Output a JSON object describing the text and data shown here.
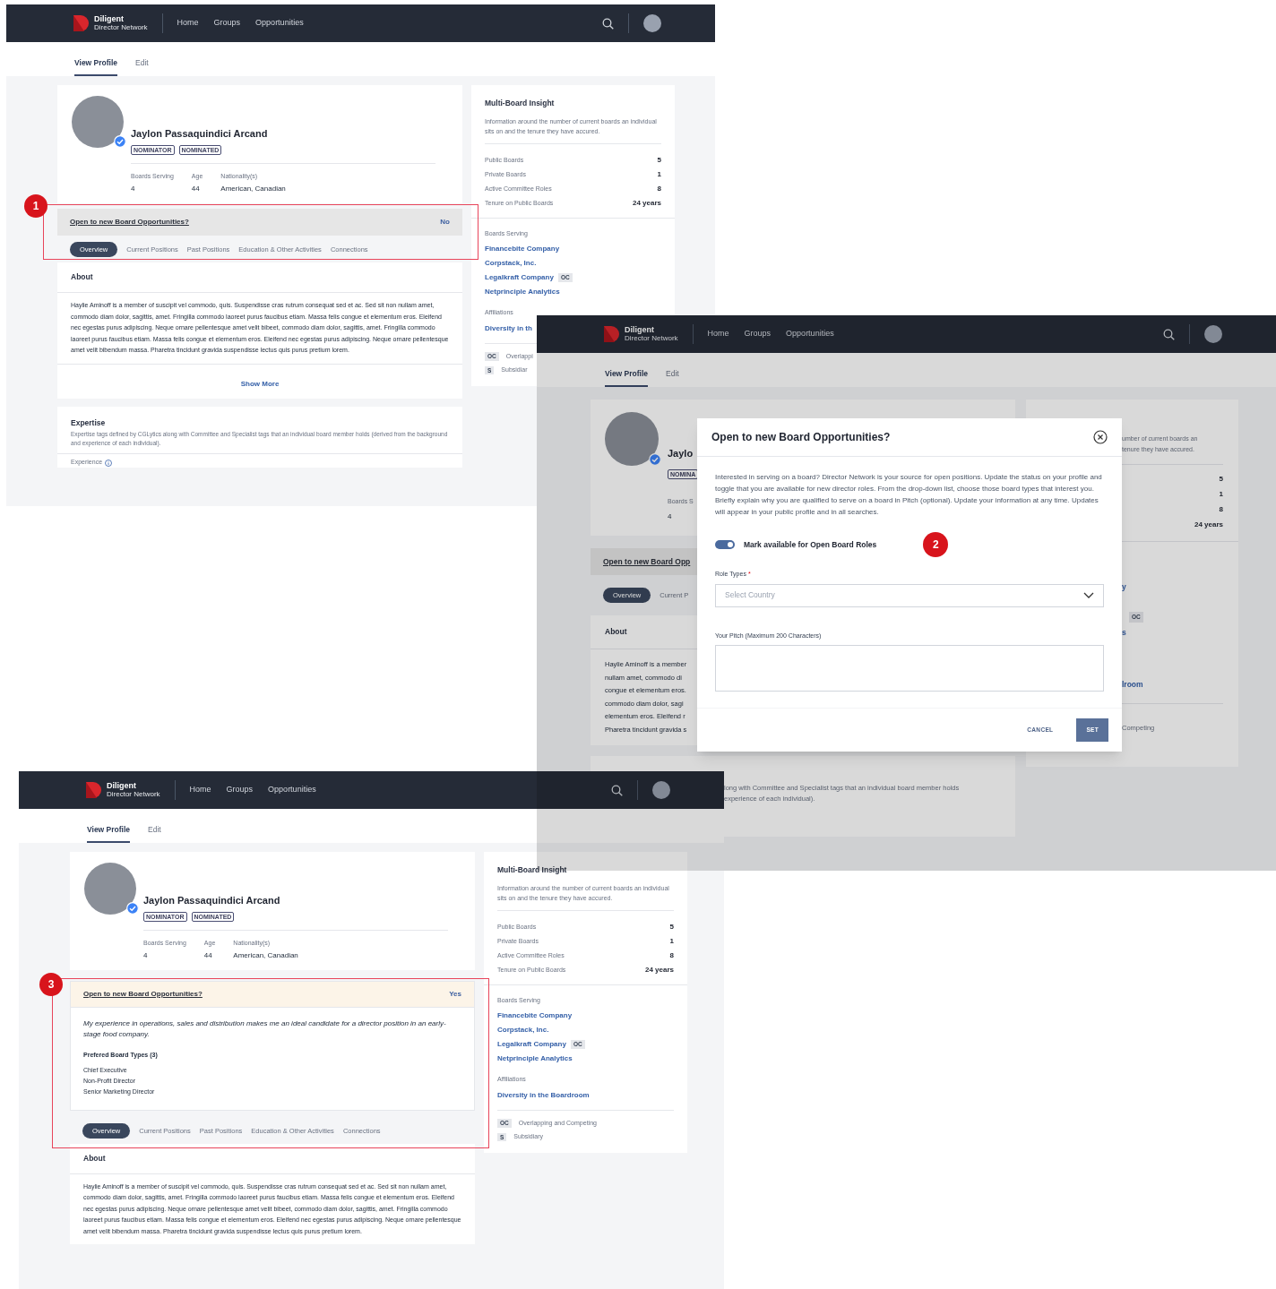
{
  "screens": [
    {
      "kind": "profile",
      "nav": {
        "brand": [
          "Diligent",
          "Director Network"
        ],
        "links": [
          "Home",
          "Groups",
          "Opportunities"
        ]
      },
      "page_tabs": [
        {
          "label": "View Profile",
          "selected": true
        },
        {
          "label": "Edit",
          "selected": false
        }
      ],
      "profile": {
        "name": "Jaylon Passaquindici Arcand",
        "badges": [
          "NOMINATOR",
          "NOMINATED"
        ],
        "stats": [
          {
            "label": "Boards Serving",
            "value": "4"
          },
          {
            "label": "Age",
            "value": "44"
          },
          {
            "label": "Nationality(s)",
            "value": "American, Canadian"
          }
        ]
      },
      "opportunity": {
        "question": "Open to new Board Opportunities?",
        "answer": "No",
        "expanded": false
      },
      "section_tabs": [
        {
          "label": "Overview",
          "selected": true
        },
        {
          "label": "Current Positions",
          "selected": false
        },
        {
          "label": "Past Positions",
          "selected": false
        },
        {
          "label": "Education & Other Activities",
          "selected": false
        },
        {
          "label": "Connections",
          "selected": false
        }
      ],
      "about": {
        "title": "About",
        "text": "Haylie Aminoff is a member of suscipit vel commodo, quis. Suspendisse cras rutrum consequat sed et ac. Sed sit non nullam amet, commodo diam dolor, sagittis, amet. Fringilla commodo laoreet purus faucibus etiam. Massa felis congue et elementum eros. Eleifend nec egestas purus adipiscing. Neque ornare pellentesque amet velit bibeet, commodo diam dolor, sagittis, amet. Fringilla commodo laoreet purus faucibus etiam. Massa felis congue et elementum eros. Eleifend nec egestas purus adipiscing. Neque ornare pellentesque amet velit bibendum massa. Pharetra tincidunt gravida suspendisse lectus quis purus pretium lorem.",
        "action": "Show More"
      },
      "expertise": {
        "title": "Expertise",
        "description": "Expertise tags defined by CGLytics along with Committee and Specialist tags that an individual board member holds (derived from the background and experience of each individual).",
        "experience_label": "Experience"
      },
      "insight": {
        "title": "Multi-Board Insight",
        "description": "Information around the number of current boards an individual sits on and the tenure they have accured.",
        "metrics": [
          {
            "label": "Public Boards",
            "value": "5"
          },
          {
            "label": "Private Boards",
            "value": "1"
          },
          {
            "label": "Active Committee Roles",
            "value": "8"
          },
          {
            "label": "Tenure on Public Boards",
            "value": "24 years"
          }
        ],
        "boards_label": "Boards Serving",
        "boards": [
          {
            "name": "Financebite Company"
          },
          {
            "name": "Corpstack, Inc."
          },
          {
            "name": "Legalkraft Company",
            "tag": "OC"
          },
          {
            "name": "Netprinciple Analytics"
          }
        ],
        "affiliations_label": "Affiliations",
        "affiliations": [
          "Diversity in th"
        ],
        "legend": [
          {
            "code": "OC",
            "label": "Overlappi"
          },
          {
            "code": "S",
            "label": "Subsidiar"
          }
        ]
      },
      "annotation": {
        "number": "1"
      }
    },
    {
      "kind": "modal_over_profile",
      "nav": {
        "brand": [
          "Diligent",
          "Director Network"
        ],
        "links": [
          "Home",
          "Groups",
          "Opportunities"
        ]
      },
      "page_tabs": [
        {
          "label": "View Profile",
          "selected": true
        },
        {
          "label": "Edit",
          "selected": false
        }
      ],
      "background": {
        "left": {
          "name": "Jaylo",
          "badge": "NOMINA",
          "stat_label": "Boards S",
          "stat_value": "4",
          "opportunity": "Open to new Board Opp",
          "section_tabs": [
            {
              "label": "Overview",
              "selected": true
            },
            {
              "label": "Current P",
              "selected": false
            }
          ],
          "about_title": "About",
          "about_lines": [
            "Haylie Aminoff is a member",
            "nullam amet, commodo di",
            "congue et elementum eros.",
            "commodo diam dolor, sagi",
            "elementum eros. Eleifend r",
            "Pharetra tincidunt gravida s"
          ],
          "expertise_lines": [
            "long with Committee and Specialist tags that an individual board member holds",
            "experience of each individual)."
          ]
        },
        "right": {
          "description_lines": [
            "umber of current boards an",
            "tenure they have accured."
          ],
          "values": [
            "5",
            "1",
            "8",
            "24 years"
          ],
          "boards": [
            {
              "kind": "text",
              "text": "y"
            },
            {
              "kind": "gap"
            },
            {
              "kind": "tag",
              "text": "OC"
            },
            {
              "kind": "text",
              "text": "s"
            }
          ],
          "affiliation": "lroom",
          "legend": "Competing"
        }
      },
      "modal": {
        "title": "Open to new Board Opportunities?",
        "description": "Interested in serving on a board? Director Network is your source for open positions. Update the status on your profile and toggle that you are available for new director roles. From the drop-down list, choose those board types that interest you. Briefly explain why you are qualified to serve on a board in Pitch (optional). Update your information at any time. Updates will appear in your public profile and in all searches.",
        "toggle": {
          "label": "Mark available for Open Board Roles",
          "on": true
        },
        "role_types": {
          "label": "Role Types",
          "required_mark": "*",
          "placeholder": "Select Country"
        },
        "pitch": {
          "label": "Your Pitch (Maximum 200 Characters)"
        },
        "buttons": [
          {
            "label": "CANCEL",
            "kind": "text"
          },
          {
            "label": "SET",
            "kind": "primary"
          }
        ],
        "annotation": {
          "number": "2"
        }
      }
    },
    {
      "kind": "profile",
      "nav": {
        "brand": [
          "Diligent",
          "Director Network"
        ],
        "links": [
          "Home",
          "Groups",
          "Opportunities"
        ]
      },
      "page_tabs": [
        {
          "label": "View Profile",
          "selected": true
        },
        {
          "label": "Edit",
          "selected": false
        }
      ],
      "profile": {
        "name": "Jaylon Passaquindici Arcand",
        "badges": [
          "NOMINATOR",
          "NOMINATED"
        ],
        "stats": [
          {
            "label": "Boards Serving",
            "value": "4"
          },
          {
            "label": "Age",
            "value": "44"
          },
          {
            "label": "Nationality(s)",
            "value": "American, Canadian"
          }
        ]
      },
      "opportunity": {
        "question": "Open to new Board Opportunities?",
        "answer": "Yes",
        "expanded": true,
        "pitch": "My experience in operations, sales and distribution makes me an ideal candidate for a director position in an early-stage food company.",
        "types_title": "Prefered Board Types (3)",
        "types": [
          "Chief Executive",
          "Non-Profit Director",
          "Senior Marketing Director"
        ]
      },
      "section_tabs": [
        {
          "label": "Overview",
          "selected": true
        },
        {
          "label": "Current Positions",
          "selected": false
        },
        {
          "label": "Past Positions",
          "selected": false
        },
        {
          "label": "Education & Other Activities",
          "selected": false
        },
        {
          "label": "Connections",
          "selected": false
        }
      ],
      "about": {
        "title": "About",
        "text": "Haylie Aminoff is a member of suscipit vel commodo, quis. Suspendisse cras rutrum consequat sed et ac. Sed sit non nullam amet, commodo diam dolor, sagittis, amet. Fringilla commodo laoreet purus faucibus etiam. Massa felis congue et elementum eros. Eleifend nec egestas purus adipiscing. Neque ornare pellentesque amet velit bibeet, commodo diam dolor, sagittis, amet. Fringilla commodo laoreet purus faucibus etiam. Massa felis congue et elementum eros. Eleifend nec egestas purus adipiscing. Neque ornare pellentesque amet velit bibendum massa. Pharetra tincidunt gravida suspendisse lectus quis purus pretium lorem."
      },
      "insight": {
        "title": "Multi-Board Insight",
        "description": "Information around the number of current boards an individual sits on and the tenure they have accured.",
        "metrics": [
          {
            "label": "Public Boards",
            "value": "5"
          },
          {
            "label": "Private Boards",
            "value": "1"
          },
          {
            "label": "Active Committee Roles",
            "value": "8"
          },
          {
            "label": "Tenure on Public Boards",
            "value": "24 years"
          }
        ],
        "boards_label": "Boards Serving",
        "boards": [
          {
            "name": "Financebite Company"
          },
          {
            "name": "Corpstack, Inc."
          },
          {
            "name": "Legalkraft Company",
            "tag": "OC"
          },
          {
            "name": "Netprinciple Analytics"
          }
        ],
        "affiliations_label": "Affiliations",
        "affiliations": [
          "Diversity in the Boardroom"
        ],
        "legend": [
          {
            "code": "OC",
            "label": "Overlapping and Competing"
          },
          {
            "code": "S",
            "label": "Subsidiary"
          }
        ]
      },
      "annotation": {
        "number": "3"
      }
    }
  ]
}
